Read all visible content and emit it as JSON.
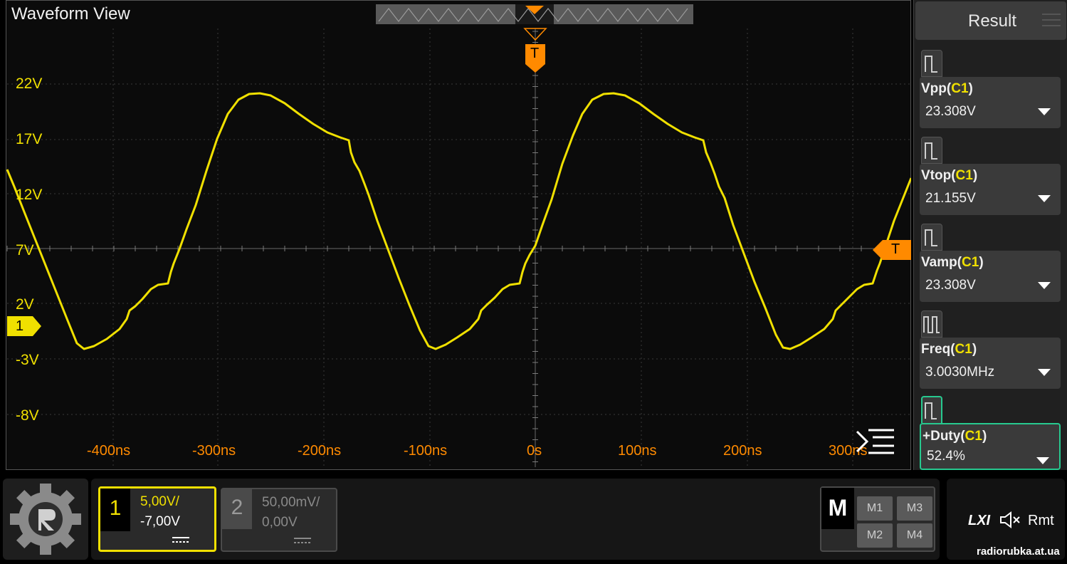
{
  "waveform_view": {
    "title": "Waveform View",
    "volt_labels": [
      "22V",
      "17V",
      "12V",
      "7V",
      "2V",
      "-3V",
      "-8V"
    ],
    "time_labels": [
      "-400ns",
      "-300ns",
      "-200ns",
      "-100ns",
      "0s",
      "100ns",
      "200ns",
      "300ns"
    ],
    "channel_marker": "1",
    "trigger_label": "T"
  },
  "result_panel": {
    "title": "Result",
    "measurements": [
      {
        "name": "Vpp",
        "channel": "C1",
        "value": "23.308V"
      },
      {
        "name": "Vtop",
        "channel": "C1",
        "value": "21.155V"
      },
      {
        "name": "Vamp",
        "channel": "C1",
        "value": "23.308V"
      },
      {
        "name": "Freq",
        "channel": "C1",
        "value": "3.0030MHz"
      },
      {
        "name": "+Duty",
        "channel": "C1",
        "value": "52.4%"
      }
    ]
  },
  "channels": {
    "ch1": {
      "number": "1",
      "scale": "5,00V/",
      "offset": "-7,00V"
    },
    "ch2": {
      "number": "2",
      "scale": "50,00mV/",
      "offset": "0,00V"
    }
  },
  "math": {
    "label": "M",
    "buttons": [
      "M1",
      "M3",
      "M2",
      "M4"
    ]
  },
  "status": {
    "lxi": "LXI",
    "remote": "Rmt"
  },
  "watermark": "radiorubka.at.ua",
  "colors": {
    "ch1": "#f0e000",
    "trigger": "#ff8a00",
    "accent_active": "#27c98f"
  }
}
